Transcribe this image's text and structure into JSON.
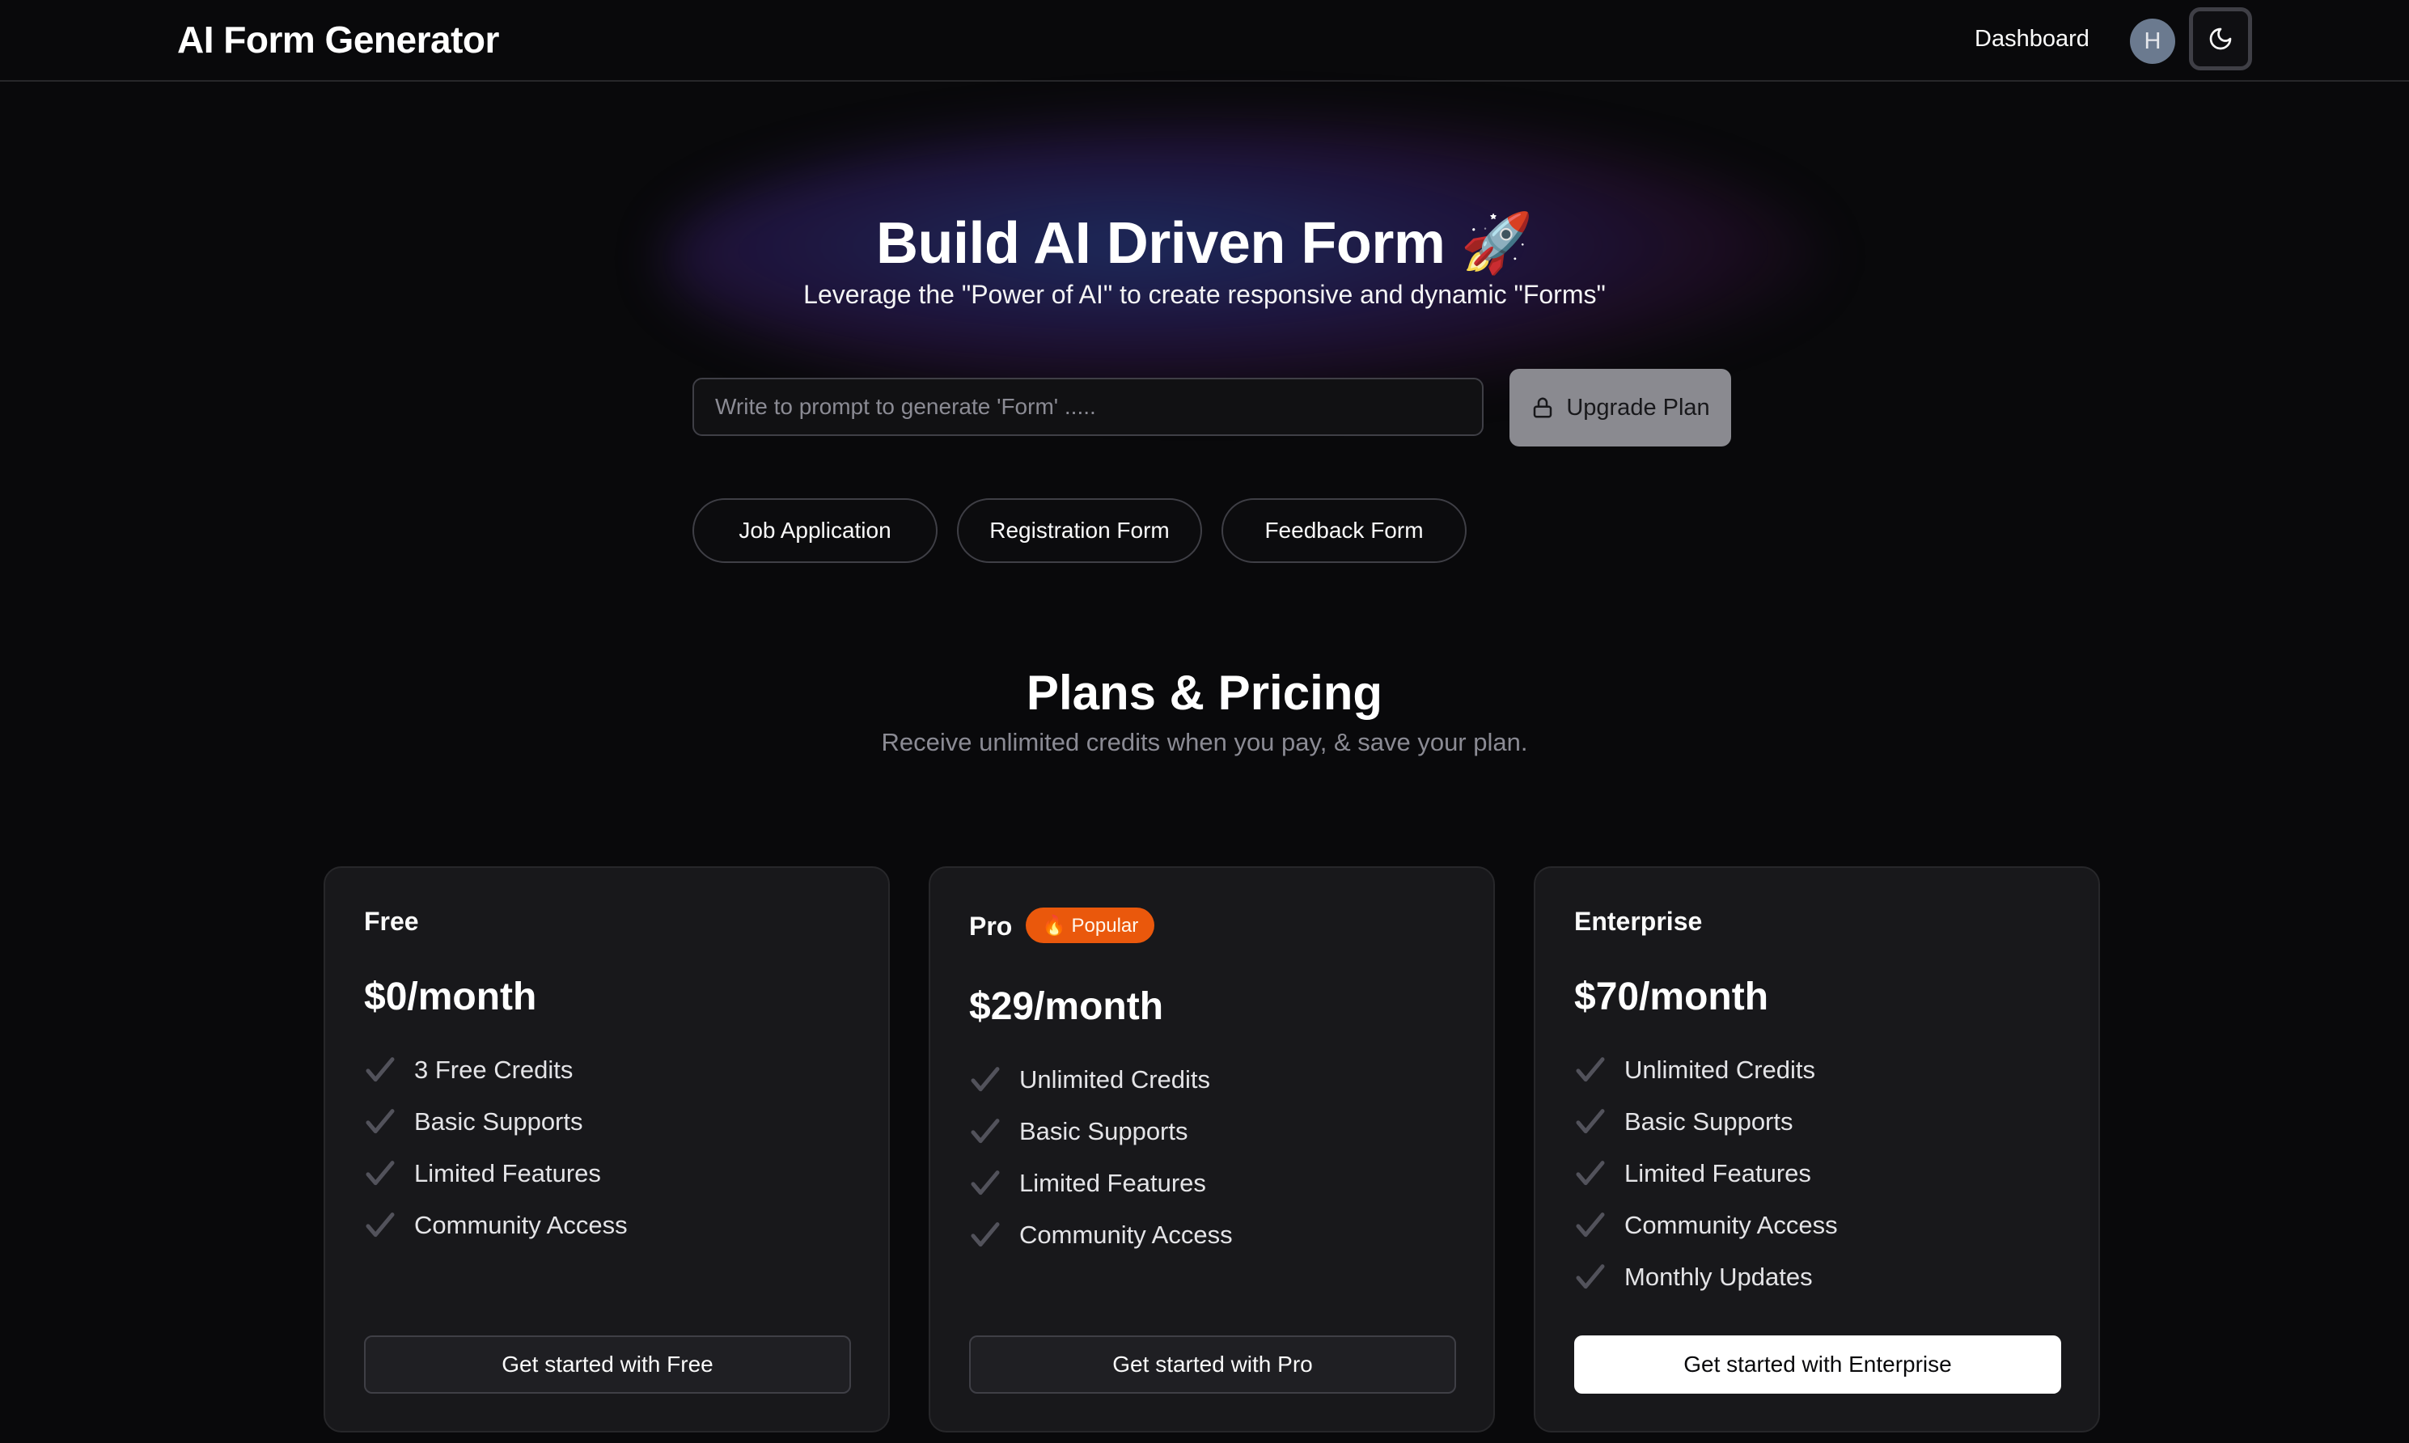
{
  "header": {
    "app_title": "AI Form Generator",
    "dashboard_label": "Dashboard",
    "avatar_initial": "H"
  },
  "hero": {
    "title": "Build AI Driven Form 🚀",
    "subtitle": "Leverage the \"Power of AI\" to create responsive and dynamic \"Forms\"",
    "prompt_placeholder": "Write to prompt to generate 'Form' .....",
    "prompt_value": "",
    "upgrade_label": "Upgrade Plan",
    "chips": [
      "Job Application",
      "Registration Form",
      "Feedback Form"
    ]
  },
  "pricing": {
    "title": "Plans & Pricing",
    "subtitle": "Receive unlimited credits when you pay, & save your plan.",
    "plans": [
      {
        "name": "Free",
        "price": "$0/month",
        "features": [
          "3 Free Credits",
          "Basic Supports",
          "Limited Features",
          "Community Access"
        ],
        "cta": "Get started with Free"
      },
      {
        "name": "Pro",
        "badge": "🔥 Popular",
        "price": "$29/month",
        "features": [
          "Unlimited Credits",
          "Basic Supports",
          "Limited Features",
          "Community Access"
        ],
        "cta": "Get started with Pro"
      },
      {
        "name": "Enterprise",
        "price": "$70/month",
        "features": [
          "Unlimited Credits",
          "Basic Supports",
          "Limited Features",
          "Community Access",
          "Monthly Updates"
        ],
        "cta": "Get started with Enterprise"
      }
    ]
  },
  "icons": {
    "theme_toggle": "moon-icon",
    "upgrade": "lock-icon",
    "feature": "check-icon"
  },
  "colors": {
    "background": "#09090b",
    "card": "#18181b",
    "badge": "#ea580c",
    "upgrade_button": "#8a8a90"
  }
}
